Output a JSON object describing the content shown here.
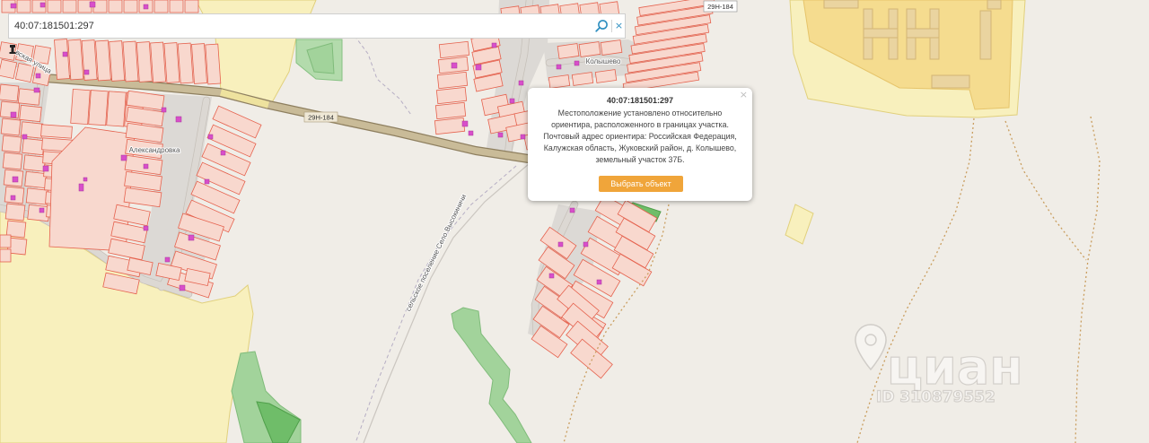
{
  "search": {
    "value": "40:07:181501:297",
    "search_icon": "search-icon",
    "clear_icon": "close-icon",
    "clear_glyph": "×"
  },
  "popup": {
    "title": "40:07:181501:297",
    "body": "Местоположение установлено относительно ориентира, расположенного в границах участка. Почтовый адрес ориентира: Российская Федерация, Калужская область, Жуковский район, д. Колышево, земельный участок 37Б.",
    "button_label": "Выбрать объект",
    "close_icon": "close-icon",
    "close_glyph": "×"
  },
  "map": {
    "labels": {
      "highway_north": "29Н-184",
      "highway_main": "29Н-184",
      "village_west": "Александровка",
      "village_center": "Колышево",
      "street": "вская улица",
      "settlement": "сельское поселение Село Высокиничи"
    },
    "icons": {
      "poi": "poi-icon",
      "watermark_pin": "location-pin-icon"
    },
    "colors": {
      "parcel_fill": "#f8d8ce",
      "parcel_border": "#e5624e",
      "building": "#d84fca",
      "green_area": "#a2d39b",
      "yellow_zone": "#f8f0bd",
      "highway": "#c9bb98",
      "action_button": "#f0a53a",
      "icon_accent": "#2f8fc0"
    }
  },
  "watermark": {
    "brand": "циан",
    "listing_id": "ID 310879552"
  }
}
